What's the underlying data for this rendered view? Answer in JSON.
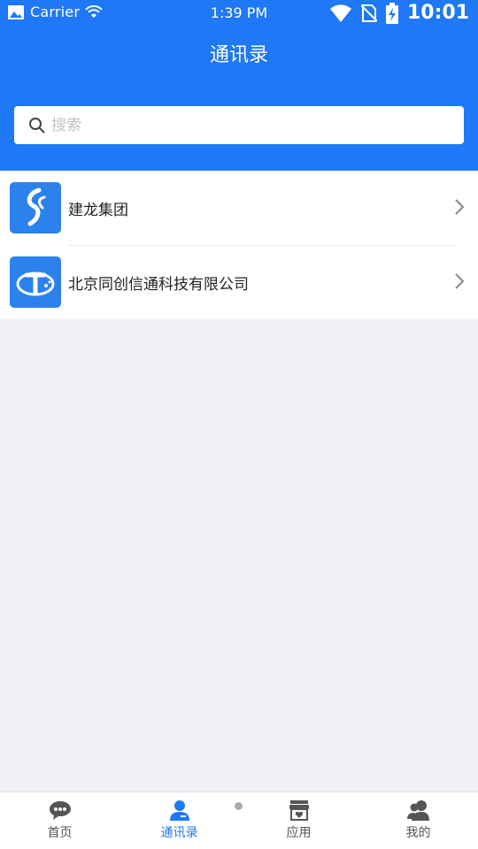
{
  "status": {
    "carrier": "Carrier",
    "time": "1:39 PM",
    "clock": "10:01"
  },
  "page": {
    "title": "通讯录"
  },
  "search": {
    "placeholder": "搜索"
  },
  "list": [
    {
      "name": "建龙集团",
      "logo_icon": "jianlong-logo-icon"
    },
    {
      "name": "北京同创信通科技有限公司",
      "logo_icon": "tongchuang-logo-icon"
    }
  ],
  "tabs": [
    {
      "label": "首页",
      "icon": "chat-bubble-icon",
      "active": false
    },
    {
      "label": "通讯录",
      "icon": "contact-person-icon",
      "active": true
    },
    {
      "label": "应用",
      "icon": "store-icon",
      "active": false
    },
    {
      "label": "我的",
      "icon": "users-icon",
      "active": false
    }
  ],
  "colors": {
    "primary": "#1f78f5",
    "background": "#eff1f5",
    "inactive": "#555555"
  }
}
